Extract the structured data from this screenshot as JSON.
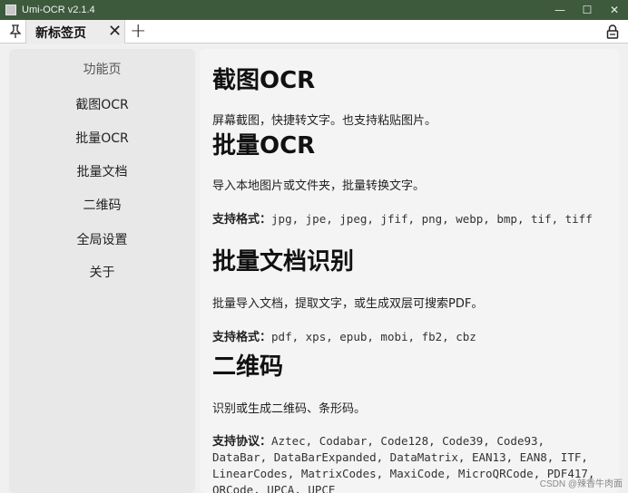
{
  "window": {
    "title": "Umi-OCR v2.1.4",
    "controls": {
      "minimize": "—",
      "maximize": "☐",
      "close": "✕"
    }
  },
  "tabs": {
    "active_label": "新标签页",
    "close_glyph": "✕",
    "add_glyph": "+"
  },
  "sidebar": {
    "title": "功能页",
    "items": [
      {
        "label": "截图OCR"
      },
      {
        "label": "批量OCR"
      },
      {
        "label": "批量文档"
      },
      {
        "label": "二维码"
      },
      {
        "label": "全局设置"
      },
      {
        "label": "关于"
      }
    ]
  },
  "main": {
    "sections": [
      {
        "heading": "截图OCR",
        "desc": "屏幕截图，快捷转文字。也支持粘贴图片。"
      },
      {
        "heading": "批量OCR",
        "desc": "导入本地图片或文件夹，批量转换文字。",
        "formats_label": "支持格式：",
        "formats": "jpg, jpe, jpeg, jfif, png, webp, bmp, tif, tiff"
      },
      {
        "heading": "批量文档识别",
        "desc": "批量导入文档，提取文字，或生成双层可搜索PDF。",
        "formats_label": "支持格式：",
        "formats": "pdf, xps, epub, mobi, fb2, cbz"
      },
      {
        "heading": "二维码",
        "desc": "识别或生成二维码、条形码。",
        "formats_label": "支持协议：",
        "formats": "Aztec, Codabar, Code128, Code39, Code93, DataBar, DataBarExpanded, DataMatrix, EAN13, EAN8, ITF, LinearCodes, MatrixCodes, MaxiCode, MicroQRCode, PDF417, QRCode, UPCA, UPCE"
      }
    ]
  },
  "watermark": "CSDN @辣香牛肉面"
}
